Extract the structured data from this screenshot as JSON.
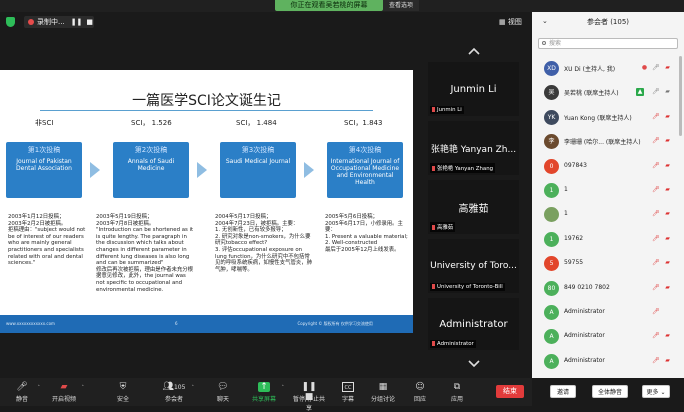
{
  "banner": {
    "text": "你正在观看吴若桃的屏幕",
    "view_options": "查看选项"
  },
  "recording": {
    "label": "录制中..."
  },
  "view_button": "视图",
  "slide": {
    "title": "一篇医学SCI论文诞生记",
    "columns": [
      {
        "header": "非SCI",
        "round": "第1次投稿",
        "journal": "Journal of Pakistan Dental Association",
        "notes": "2003年1月12日投稿；\n2003年2月2日被拒稿。\n拒稿理由：\"subject would not be of interest of our readers who are mainly general practitioners and specialists related with oral and dental sciences.\""
      },
      {
        "header": "SCI， 1.526",
        "round": "第2次投稿",
        "journal": "Annals of Saudi Medicine",
        "notes": "2003年5月19日投稿；\n2003年7月8日被拒稿。\n\"Introduction can be shortened as it is quite lengthy. The paragraph in the discussion which talks about changes in different parameter in different lung diseases is also long and can be summarized\"\n修改后再次被拒稿，理由是作者未充分根据意见修改，此外，the journal was not specific to occupational and environmental medicine."
      },
      {
        "header": "SCI， 1.484",
        "round": "第3次投稿",
        "journal": "Saudi Medical Journal",
        "notes": "2004年5月17日投稿；\n2004年7月23日，被拒稿。主要：\n1.  无创新性，已有较多报导；\n2.  研究对象是non-smokers，为什么要研究tobacco effect?\n3.  评估occupational exposure on lung function，为什么研究中不包括常见的呼吸系统疾病，如慢性支气管炎，肺气肿，哮喘等。"
      },
      {
        "header": "SCI，1.843",
        "round": "第4次投稿",
        "journal": "International Journal of Occupational Medicine and Environmental Health",
        "notes": "2005年5月6日投稿；\n2005年6月17日，小修录用。主要：\n1.  Present a valuable material;\n2.  Well-constructed\n最后于2005年12月上线发表。"
      }
    ],
    "footer_left": "www.xxxxxxxxxxxx.com",
    "footer_page": "6",
    "footer_right": "Copyright © 版权所有 仅供学习交流使用"
  },
  "gallery": [
    {
      "name": "Junmin Li",
      "label": "Junmin Li"
    },
    {
      "name": "张艳艳 Yanyan Zh...",
      "label": "张艳艳 Yanyan Zhang"
    },
    {
      "name": "高雅茹",
      "label": "高雅茹"
    },
    {
      "name": "University of Toro...",
      "label": "University of Toronto-Bill"
    },
    {
      "name": "Administrator",
      "label": "Administrator"
    }
  ],
  "participants": {
    "title": "参会者 (105)",
    "search_placeholder": "搜索",
    "list": [
      {
        "avatar": "XD",
        "color": "#3f5fa8",
        "name": "XU Di (主持人, 我)",
        "state": "host"
      },
      {
        "avatar": "吴",
        "color": "#3a3a3a",
        "name": "吴若桃 (联席主持人)",
        "state": "active"
      },
      {
        "avatar": "YK",
        "color": "#3e4a5e",
        "name": "Yuan Kong (联席主持人)",
        "state": "muted"
      },
      {
        "avatar": "李",
        "color": "#6b4a2e",
        "name": "李珊珊 (哈尔... (联席主持人)",
        "state": "muted"
      },
      {
        "avatar": "0",
        "color": "#e2462b",
        "name": "097843",
        "state": "muted"
      },
      {
        "avatar": "1",
        "color": "#4cb05b",
        "name": "1",
        "state": "muted"
      },
      {
        "avatar": "",
        "color": "#7aa060",
        "name": "1",
        "state": "muted"
      },
      {
        "avatar": "1",
        "color": "#4cb05b",
        "name": "19762",
        "state": "muted"
      },
      {
        "avatar": "5",
        "color": "#e2462b",
        "name": "59755",
        "state": "muted"
      },
      {
        "avatar": "80",
        "color": "#4cb05b",
        "name": "849 0210 7802",
        "state": "muted"
      },
      {
        "avatar": "A",
        "color": "#4cb05b",
        "name": "Administrator",
        "state": "micmuted"
      },
      {
        "avatar": "A",
        "color": "#4cb05b",
        "name": "Administrator",
        "state": "muted"
      },
      {
        "avatar": "A",
        "color": "#4cb05b",
        "name": "Administrator",
        "state": "muted"
      }
    ],
    "invite": "邀请",
    "mute_all": "全体静音",
    "more": "更多"
  },
  "toolbar": {
    "mute": "静音",
    "video": "开启视频",
    "security": "安全",
    "participants": "参会者",
    "participants_count": "105",
    "chat": "聊天",
    "share": "共享屏幕",
    "pause_share": "暂停/停止共享",
    "captions": "字幕",
    "breakout": "分组讨论",
    "reactions": "回应",
    "apps": "应用",
    "end": "结束"
  }
}
